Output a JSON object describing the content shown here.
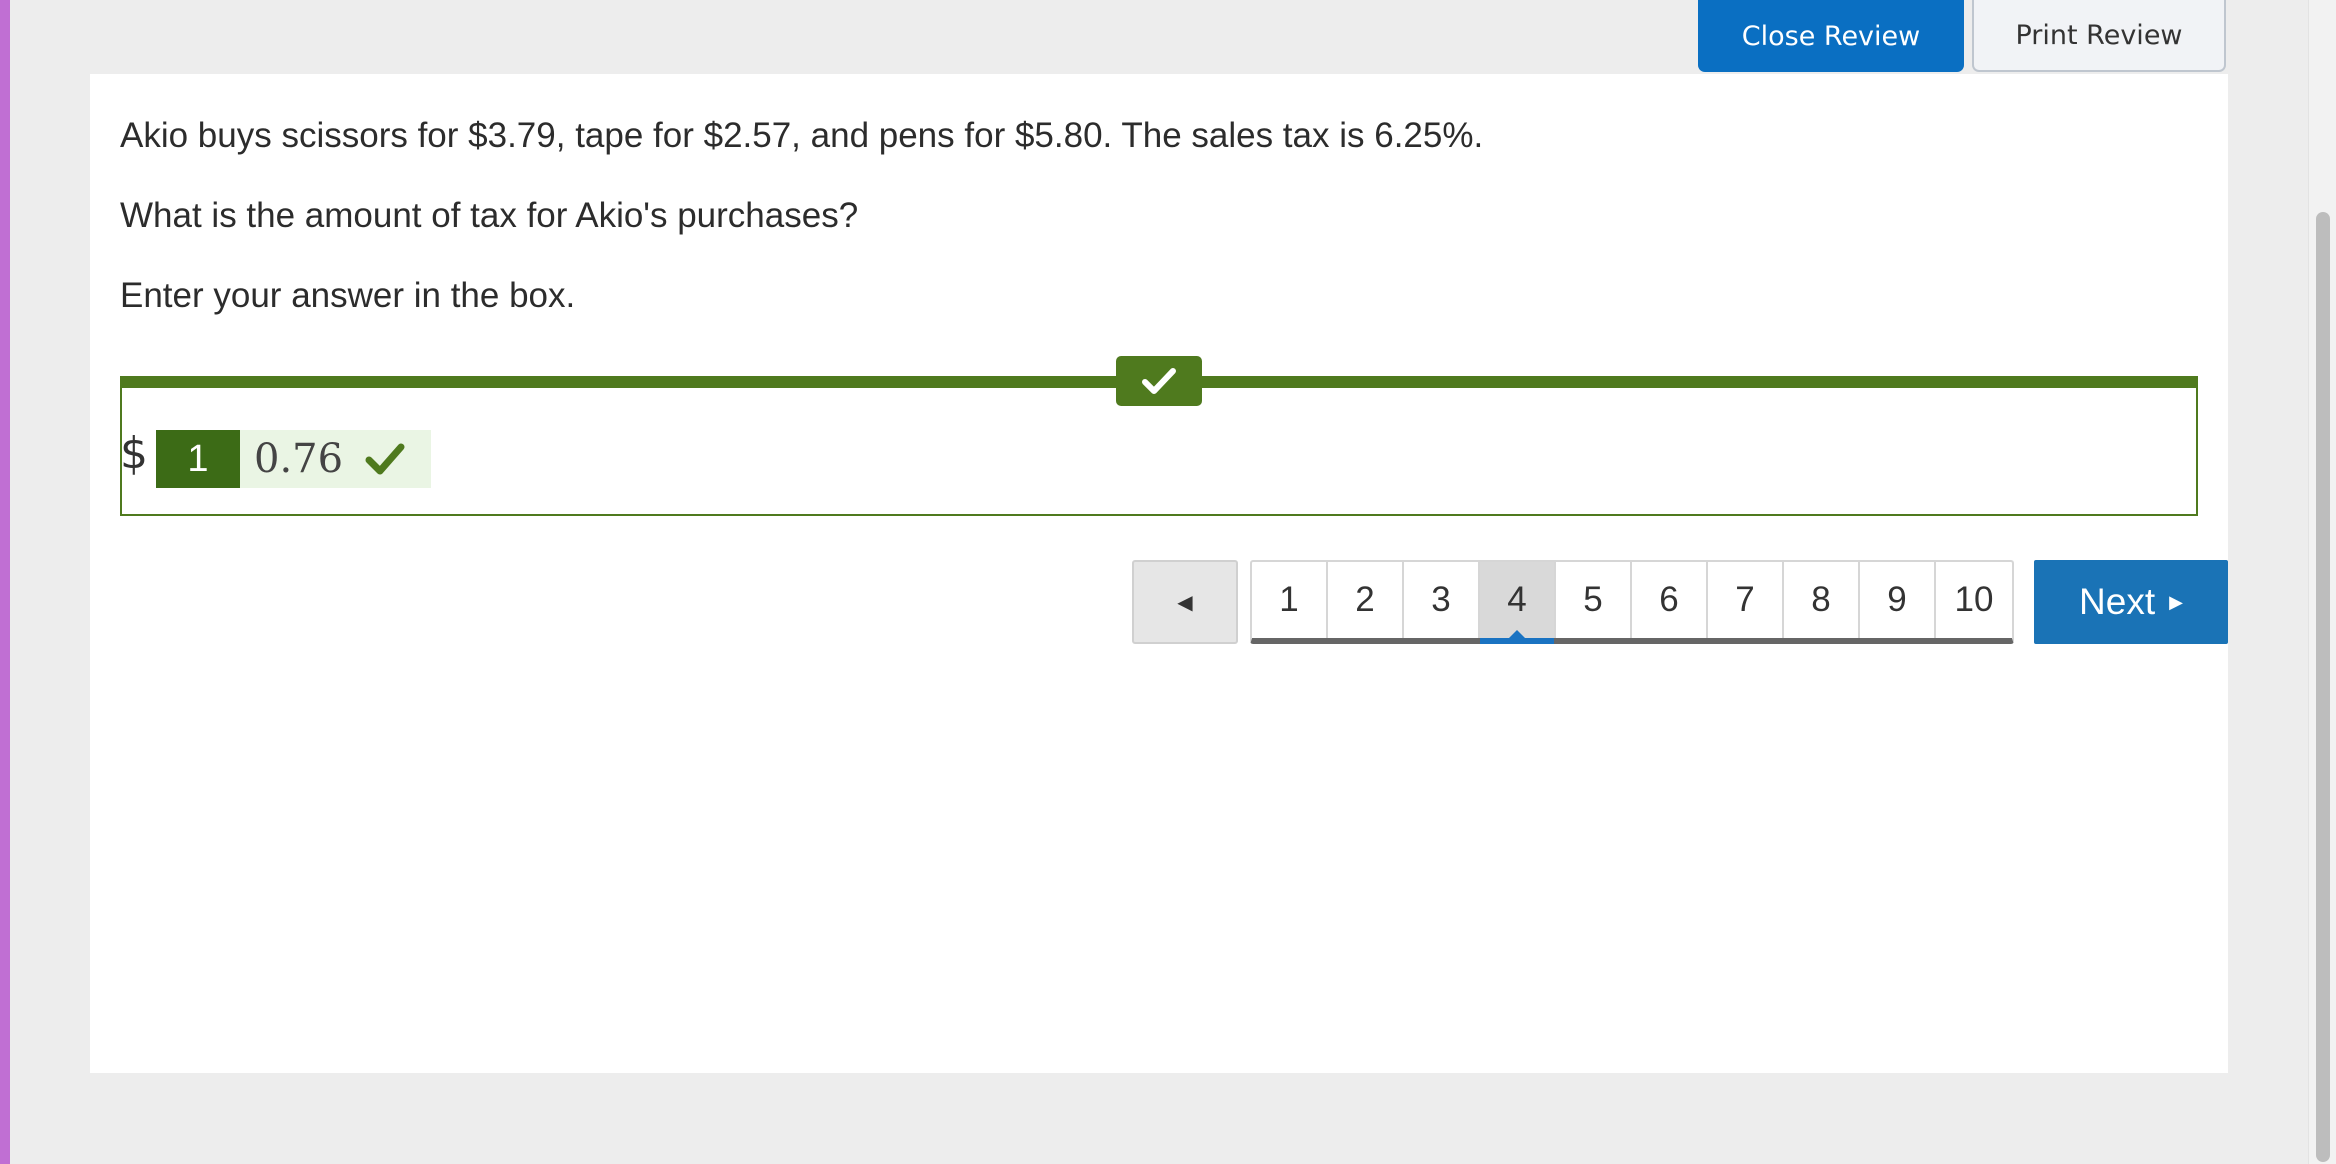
{
  "header": {
    "close_review_label": "Close Review",
    "print_review_label": "Print Review"
  },
  "question": {
    "prompt": "Akio buys scissors for $3.79, tape for $2.57, and pens for $5.80. The sales tax is 6.25%.",
    "ask": "What is the amount of tax for Akio's purchases?",
    "instruction": "Enter your answer in the box."
  },
  "response": {
    "currency_symbol": "$",
    "answer_number": "1",
    "answer_value": "0.76",
    "status": "correct",
    "check_icon": "check-icon",
    "accent_color": "#4f7a1e"
  },
  "pagination": {
    "prev_icon": "triangle-left-icon",
    "prev_glyph": "◀",
    "pages": [
      "1",
      "2",
      "3",
      "4",
      "5",
      "6",
      "7",
      "8",
      "9",
      "10"
    ],
    "current_page": "4",
    "next_label": "Next",
    "next_glyph": "▶"
  }
}
